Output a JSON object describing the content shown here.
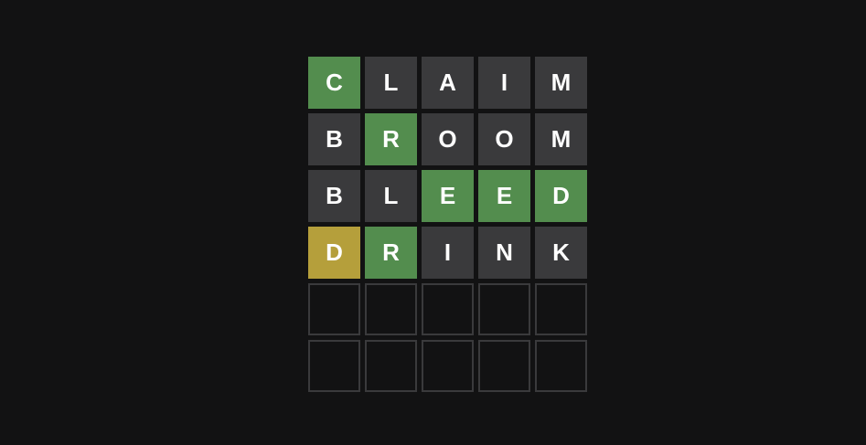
{
  "board": {
    "rows": [
      {
        "letters": [
          "C",
          "L",
          "A",
          "I",
          "M"
        ],
        "states": [
          "correct",
          "absent",
          "absent",
          "absent",
          "absent"
        ]
      },
      {
        "letters": [
          "B",
          "R",
          "O",
          "O",
          "M"
        ],
        "states": [
          "absent",
          "correct",
          "absent",
          "absent",
          "absent"
        ]
      },
      {
        "letters": [
          "B",
          "L",
          "E",
          "E",
          "D"
        ],
        "states": [
          "absent",
          "absent",
          "correct",
          "correct",
          "correct"
        ]
      },
      {
        "letters": [
          "D",
          "R",
          "I",
          "N",
          "K"
        ],
        "states": [
          "present",
          "correct",
          "absent",
          "absent",
          "absent"
        ]
      },
      {
        "letters": [
          "",
          "",
          "",
          "",
          ""
        ],
        "states": [
          "empty",
          "empty",
          "empty",
          "empty",
          "empty"
        ]
      },
      {
        "letters": [
          "",
          "",
          "",
          "",
          ""
        ],
        "states": [
          "empty",
          "empty",
          "empty",
          "empty",
          "empty"
        ]
      }
    ]
  },
  "colors": {
    "correct": "#538d4e",
    "present": "#b59f3b",
    "absent": "#3a3a3c",
    "background": "#121213"
  }
}
